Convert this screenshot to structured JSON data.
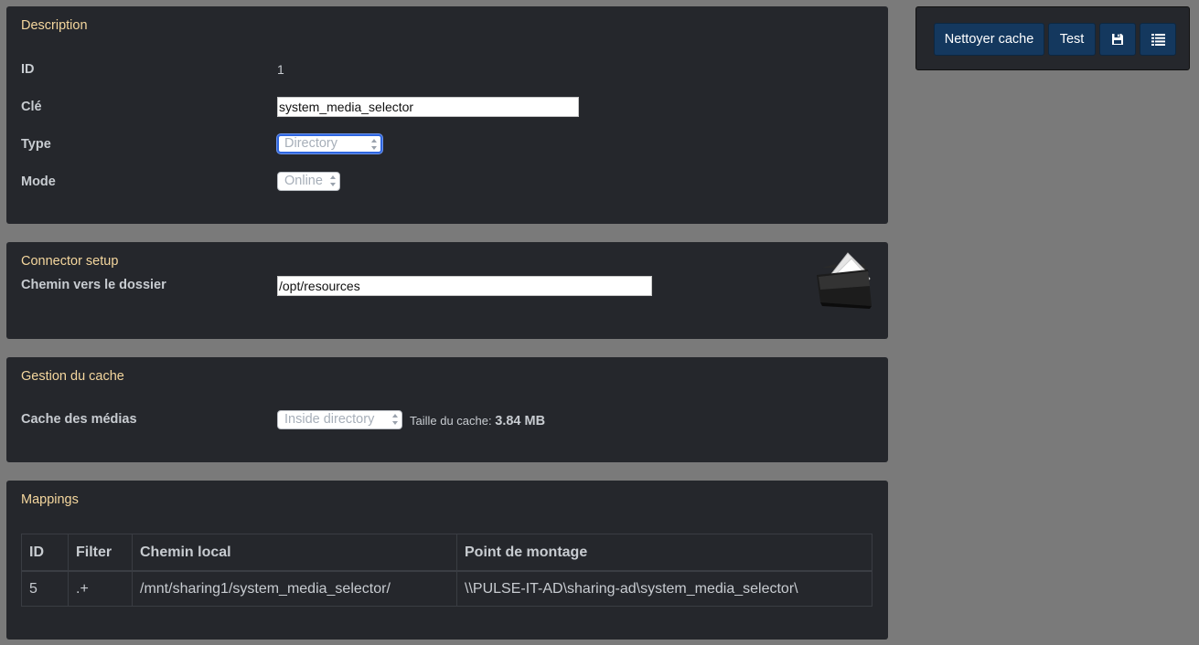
{
  "toolbar": {
    "clear_cache_label": "Nettoyer cache",
    "test_label": "Test",
    "save_icon": "save-icon",
    "list_icon": "list-icon",
    "button_color": "#14385e"
  },
  "description": {
    "title": "Description",
    "id_label": "ID",
    "id_value": "1",
    "key_label": "Clé",
    "key_value": "system_media_selector",
    "type_label": "Type",
    "type_value": "Directory",
    "mode_label": "Mode",
    "mode_value": "Online"
  },
  "connector": {
    "title": "Connector setup",
    "path_label": "Chemin vers le dossier",
    "path_value": "/opt/resources",
    "icon": "folder-icon"
  },
  "cache": {
    "title": "Gestion du cache",
    "media_cache_label": "Cache des médias",
    "media_cache_value": "Inside directory",
    "size_label": "Taille du cache:",
    "size_value": "3.84 MB"
  },
  "mappings": {
    "title": "Mappings",
    "columns": [
      "ID",
      "Filter",
      "Chemin local",
      "Point de montage"
    ],
    "rows": [
      [
        "5",
        ".+",
        "/mnt/sharing1/system_media_selector/",
        "\\\\PULSE-IT-AD\\sharing-ad\\system_media_selector\\"
      ]
    ]
  },
  "colors": {
    "background": "#7a7a7a",
    "panel": "#25272c",
    "title_accent": "#f5d79e"
  }
}
